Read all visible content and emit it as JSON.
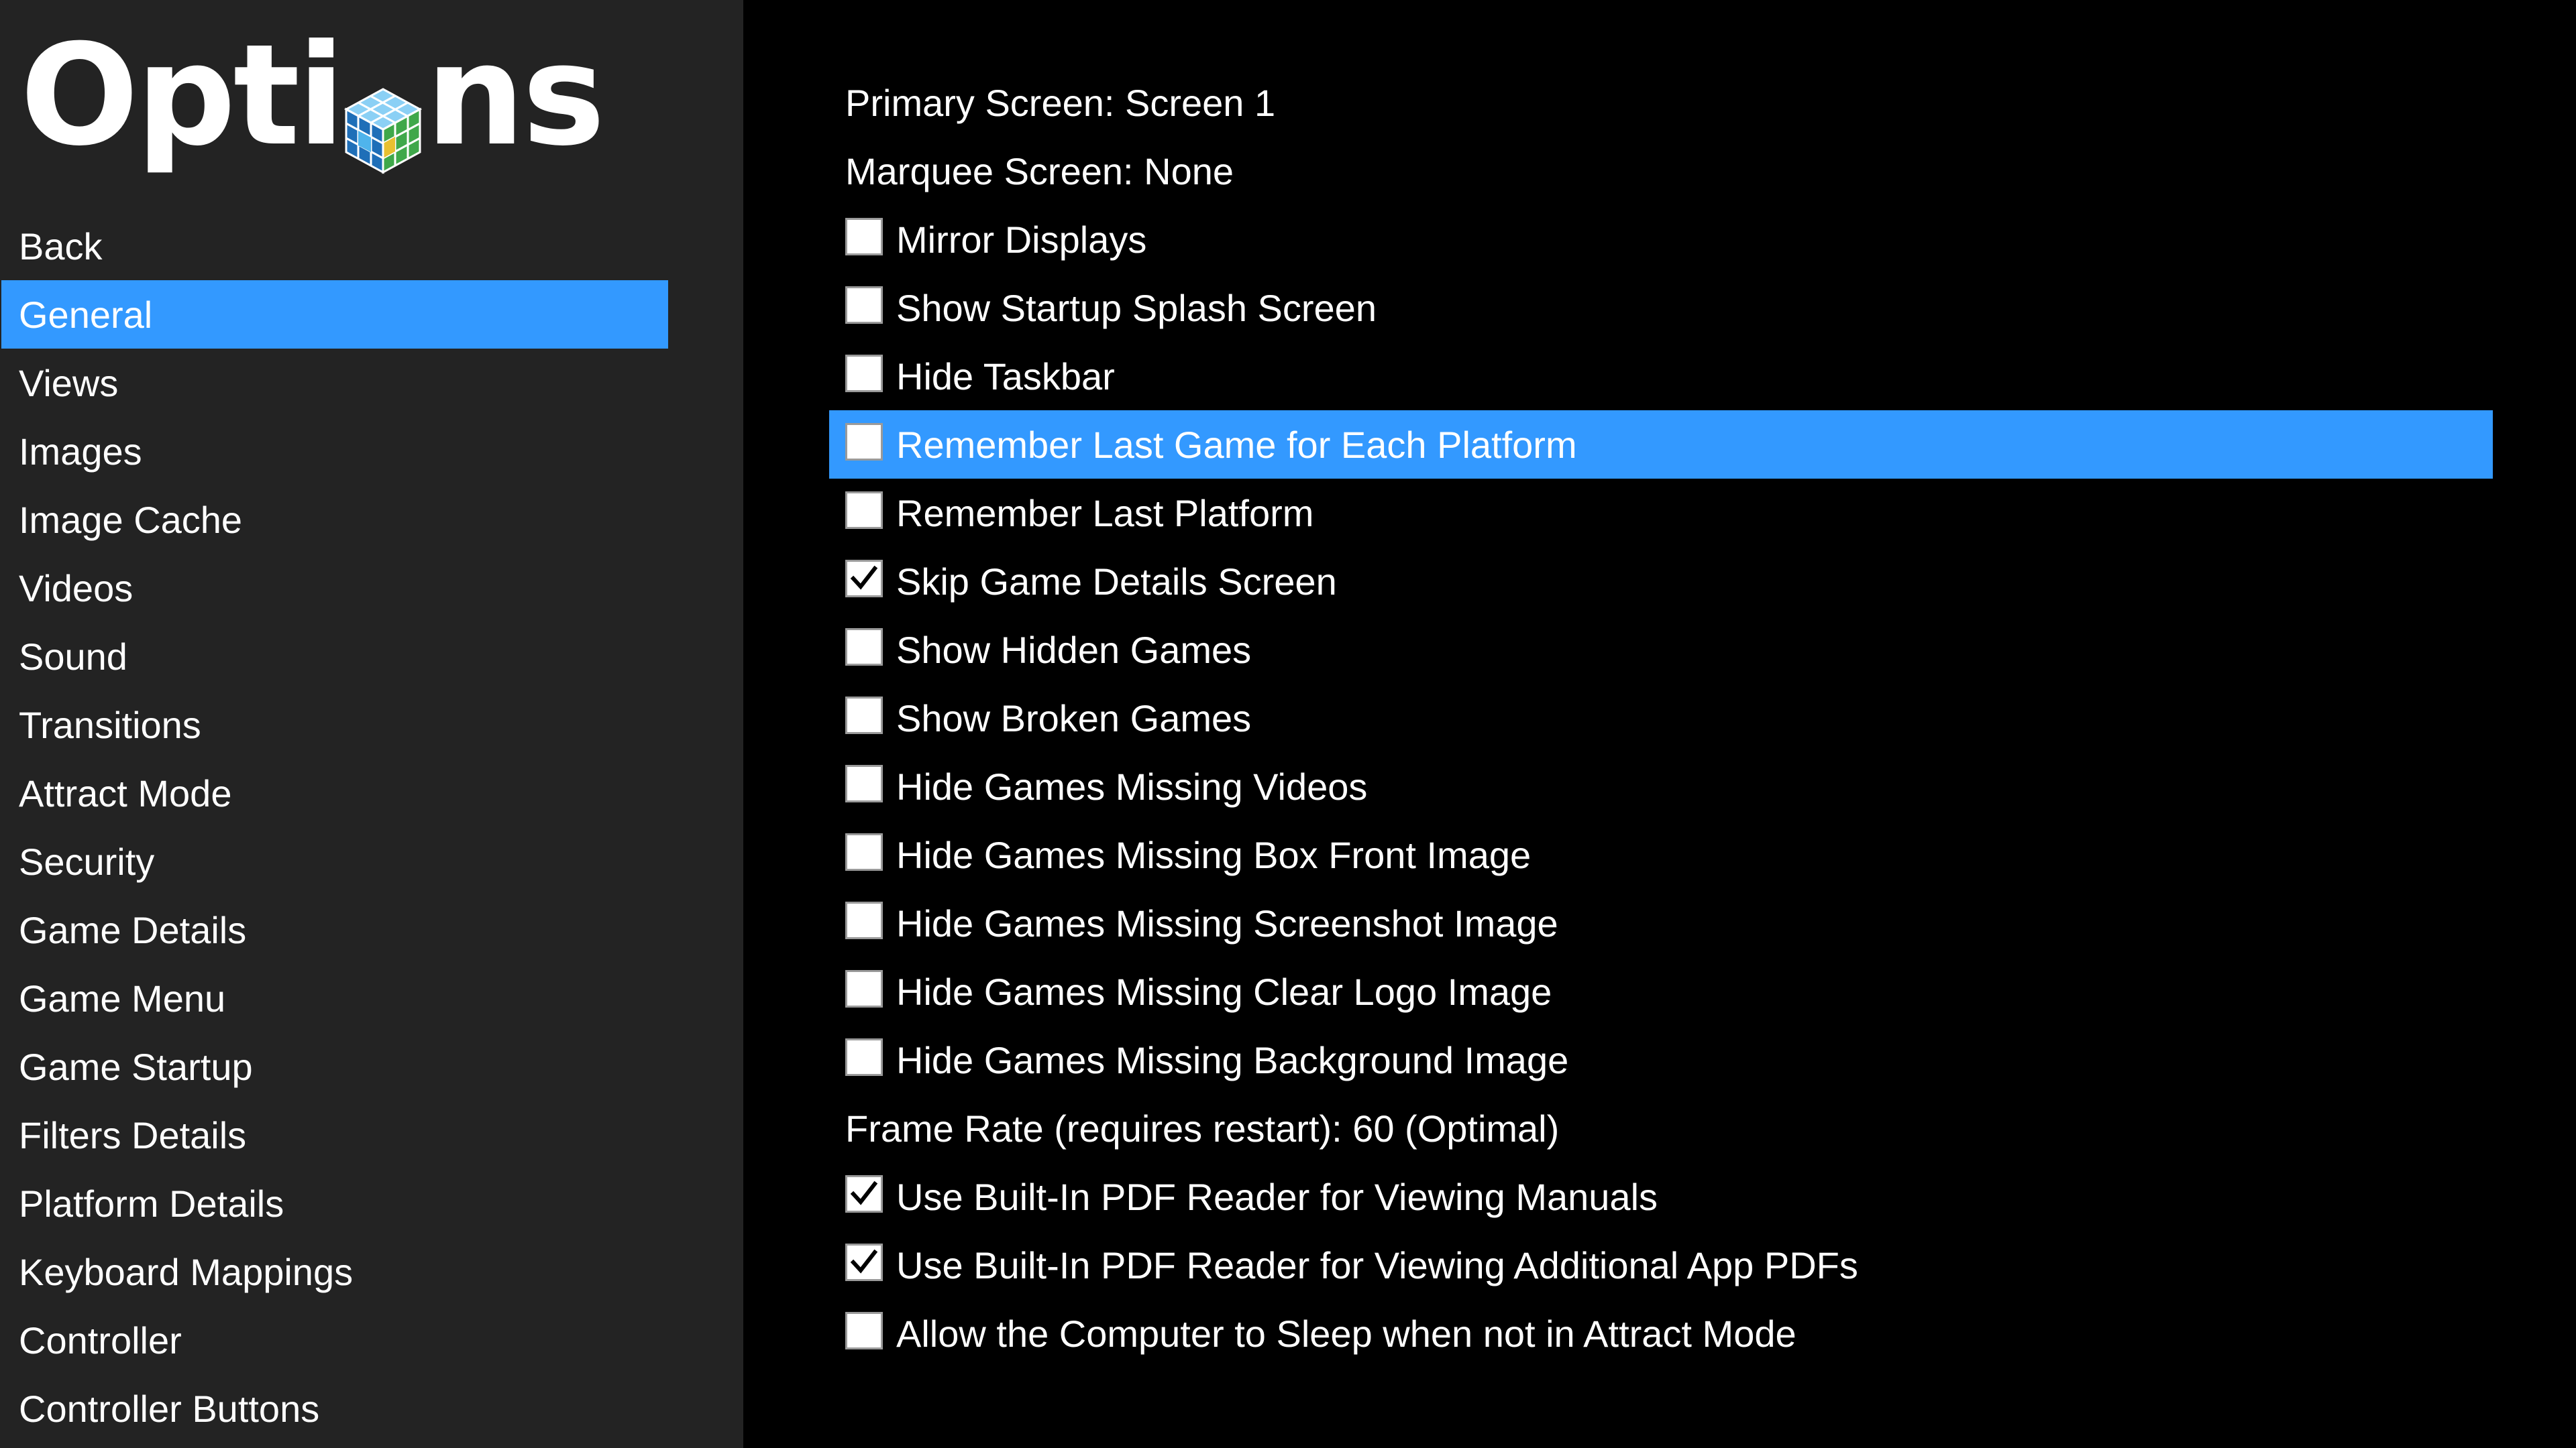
{
  "app": {
    "title": "Options"
  },
  "colors": {
    "sidebar_bg": "#232323",
    "main_bg": "#000000",
    "accent": "#3399ff",
    "text": "#ffffff"
  },
  "sidebar": {
    "items": [
      {
        "label": "Back",
        "selected": false
      },
      {
        "label": "General",
        "selected": true
      },
      {
        "label": "Views",
        "selected": false
      },
      {
        "label": "Images",
        "selected": false
      },
      {
        "label": "Image Cache",
        "selected": false
      },
      {
        "label": "Videos",
        "selected": false
      },
      {
        "label": "Sound",
        "selected": false
      },
      {
        "label": "Transitions",
        "selected": false
      },
      {
        "label": "Attract Mode",
        "selected": false
      },
      {
        "label": "Security",
        "selected": false
      },
      {
        "label": "Game Details",
        "selected": false
      },
      {
        "label": "Game Menu",
        "selected": false
      },
      {
        "label": "Game Startup",
        "selected": false
      },
      {
        "label": "Filters Details",
        "selected": false
      },
      {
        "label": "Platform Details",
        "selected": false
      },
      {
        "label": "Keyboard Mappings",
        "selected": false
      },
      {
        "label": "Controller",
        "selected": false
      },
      {
        "label": "Controller Buttons",
        "selected": false
      }
    ]
  },
  "options": [
    {
      "type": "text",
      "label": "Primary Screen: Screen 1",
      "selected": false
    },
    {
      "type": "text",
      "label": "Marquee Screen: None",
      "selected": false
    },
    {
      "type": "checkbox",
      "label": "Mirror Displays",
      "checked": false,
      "selected": false
    },
    {
      "type": "checkbox",
      "label": "Show Startup Splash Screen",
      "checked": false,
      "selected": false
    },
    {
      "type": "checkbox",
      "label": "Hide Taskbar",
      "checked": false,
      "selected": false
    },
    {
      "type": "checkbox",
      "label": "Remember Last Game for Each Platform",
      "checked": false,
      "selected": true
    },
    {
      "type": "checkbox",
      "label": "Remember Last Platform",
      "checked": false,
      "selected": false
    },
    {
      "type": "checkbox",
      "label": "Skip Game Details Screen",
      "checked": true,
      "selected": false
    },
    {
      "type": "checkbox",
      "label": "Show Hidden Games",
      "checked": false,
      "selected": false
    },
    {
      "type": "checkbox",
      "label": "Show Broken Games",
      "checked": false,
      "selected": false
    },
    {
      "type": "checkbox",
      "label": "Hide Games Missing Videos",
      "checked": false,
      "selected": false
    },
    {
      "type": "checkbox",
      "label": "Hide Games Missing Box Front Image",
      "checked": false,
      "selected": false
    },
    {
      "type": "checkbox",
      "label": "Hide Games Missing Screenshot Image",
      "checked": false,
      "selected": false
    },
    {
      "type": "checkbox",
      "label": "Hide Games Missing Clear Logo Image",
      "checked": false,
      "selected": false
    },
    {
      "type": "checkbox",
      "label": "Hide Games Missing Background Image",
      "checked": false,
      "selected": false
    },
    {
      "type": "text",
      "label": "Frame Rate (requires restart): 60 (Optimal)",
      "selected": false
    },
    {
      "type": "checkbox",
      "label": "Use Built-In PDF Reader for Viewing Manuals",
      "checked": true,
      "selected": false
    },
    {
      "type": "checkbox",
      "label": "Use Built-In PDF Reader for Viewing Additional App PDFs",
      "checked": true,
      "selected": false
    },
    {
      "type": "checkbox",
      "label": "Allow the Computer to Sleep when not in Attract Mode",
      "checked": false,
      "selected": false
    }
  ]
}
